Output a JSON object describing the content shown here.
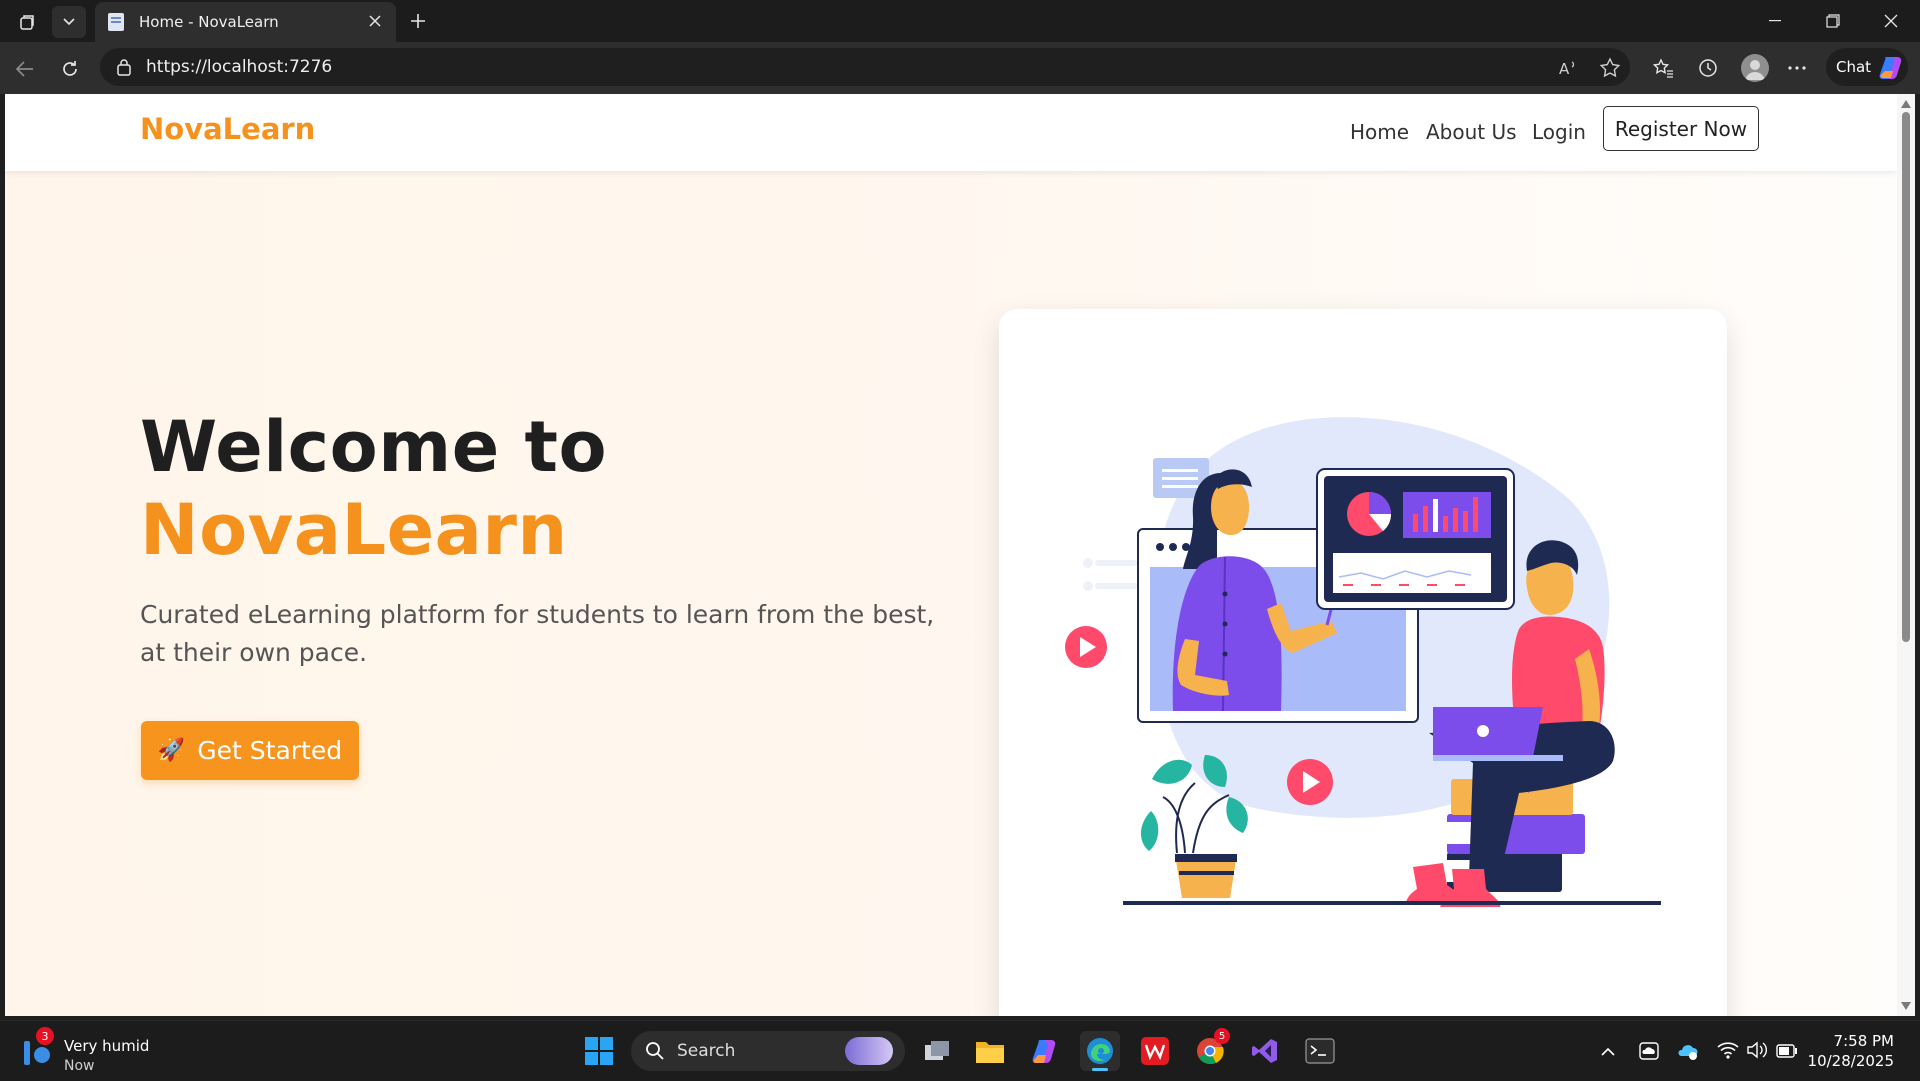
{
  "browser": {
    "tab_title": "Home - NovaLearn",
    "url": "https://localhost:7276",
    "chat_label": "Chat"
  },
  "site": {
    "brand": "NovaLearn",
    "nav": [
      {
        "label": "Home"
      },
      {
        "label": "About Us"
      },
      {
        "label": "Login"
      }
    ],
    "register_label": "Register Now",
    "hero": {
      "title_line1": "Welcome to",
      "title_line2": "NovaLearn",
      "subtitle": "Curated eLearning platform for students to learn from the best, at their own pace.",
      "cta_label": "Get Started",
      "cta_icon": "rocket-icon"
    },
    "colors": {
      "accent": "#f5921e",
      "cta": "#f7941d",
      "text_dark": "#1f1f1f"
    }
  },
  "taskbar": {
    "weather_title": "Very humid",
    "weather_sub": "Now",
    "weather_badge": "3",
    "search_placeholder": "Search",
    "time": "7:58 PM",
    "date": "10/28/2025",
    "chrome_badge": "5"
  }
}
